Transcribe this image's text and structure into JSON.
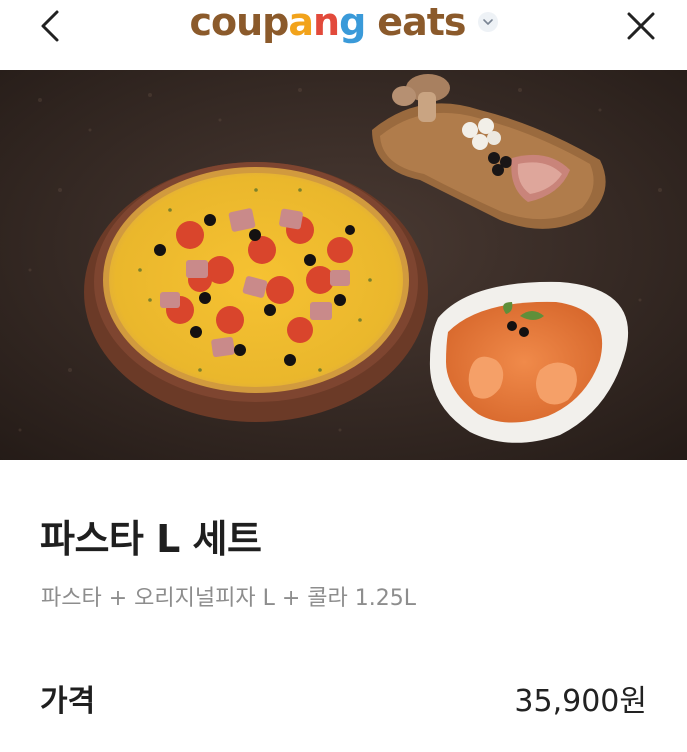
{
  "header": {
    "logo_letters": [
      {
        "ch": "c",
        "color": "#8b5a2b"
      },
      {
        "ch": "o",
        "color": "#8b5a2b"
      },
      {
        "ch": "u",
        "color": "#8b5a2b"
      },
      {
        "ch": "p",
        "color": "#8b5a2b"
      },
      {
        "ch": "a",
        "color": "#f2a31b"
      },
      {
        "ch": "n",
        "color": "#e24a3b"
      },
      {
        "ch": "g",
        "color": "#3a9ad9"
      },
      {
        "ch": " ",
        "color": "#8b5a2b"
      },
      {
        "ch": "e",
        "color": "#8b5a2b"
      },
      {
        "ch": "a",
        "color": "#8b5a2b"
      },
      {
        "ch": "t",
        "color": "#8b5a2b"
      },
      {
        "ch": "s",
        "color": "#8b5a2b"
      }
    ],
    "back_icon": "chevron-left-icon",
    "close_icon": "close-icon",
    "switch_icon": "chevron-down-icon"
  },
  "menu_item": {
    "title": "파스타 L 세트",
    "description": "파스타 + 오리지널피자 L + 콜라 1.25L",
    "price_label": "가격",
    "price_value": "35,900원"
  },
  "colors": {
    "text_primary": "#1f1f1f",
    "text_secondary": "#8d8d8d",
    "hero_bg": "#3b2f2a"
  }
}
